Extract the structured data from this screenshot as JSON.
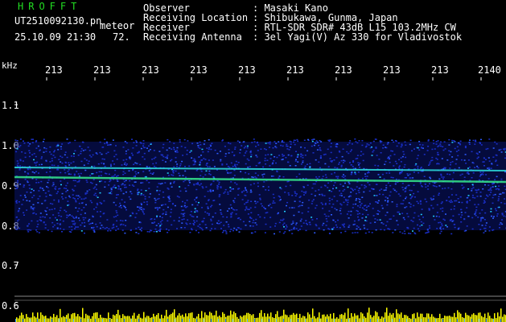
{
  "header": {
    "brand": "HROFFT",
    "file_name": "UT2510092130.pn",
    "mode": "meteor",
    "datetime": "25.10.09 21:30",
    "level": "72.",
    "rows": [
      {
        "label": "Observer",
        "value": ": Masaki Kano"
      },
      {
        "label": "Receiving Location",
        "value": ": Shibukawa, Gunma, Japan"
      },
      {
        "label": "Receiver",
        "value": ": RTL-SDR SDR# 43dB L15 103.2MHz CW"
      },
      {
        "label": "Receiving Antenna",
        "value": ": 3el Yagi(V) Az 330 for Vladivostok"
      }
    ]
  },
  "axes": {
    "y_unit": "kHz",
    "x_ticks": [
      "213",
      "213",
      "213",
      "213",
      "213",
      "213",
      "213",
      "213",
      "213",
      "2140"
    ],
    "y_ticks": [
      "1.1",
      "1.0",
      "0.9",
      "0.8",
      "0.7",
      "0.6"
    ]
  },
  "colors": {
    "background": "#000000",
    "text": "#ffffff",
    "brand": "#22dd22",
    "noise_band": "#1a2fc8",
    "signal_line": "#33dd88",
    "power_bar": "#ffff00"
  }
}
